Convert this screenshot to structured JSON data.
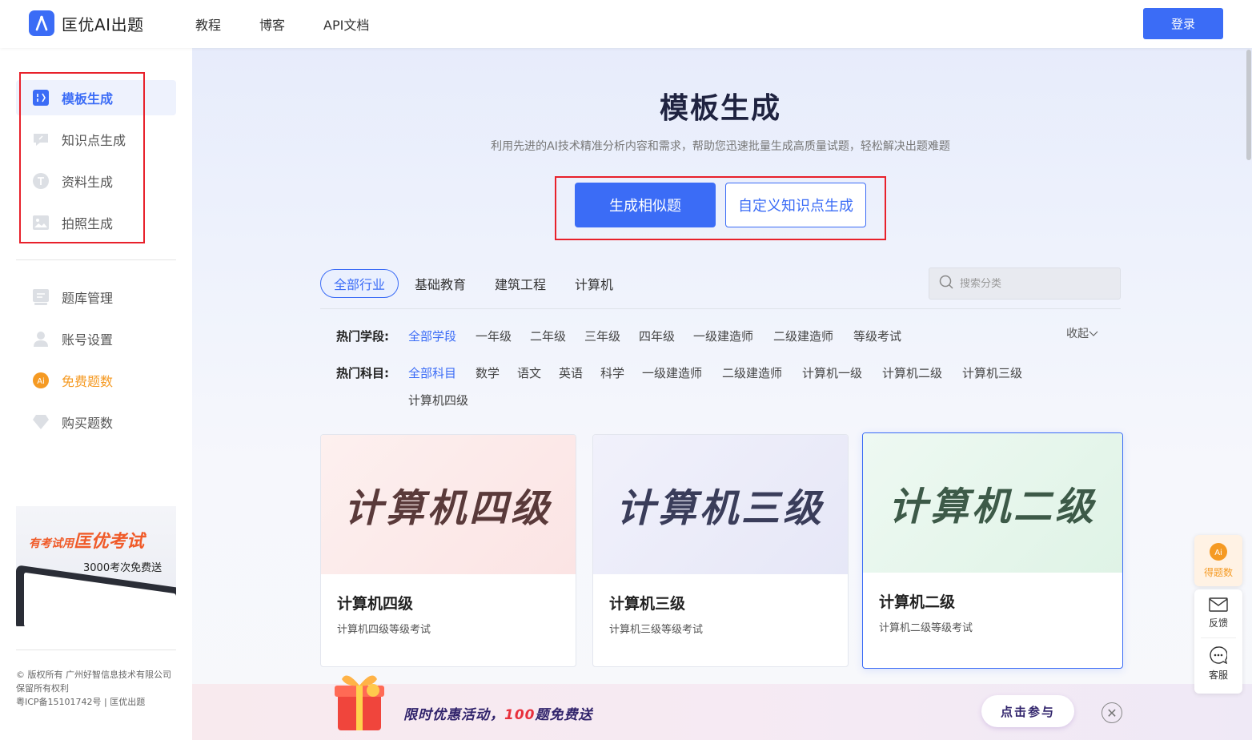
{
  "header": {
    "logo_text": "匡优AI出题",
    "nav": [
      "教程",
      "博客",
      "API文档"
    ],
    "login_label": "登录"
  },
  "sidebar": {
    "generate_items": [
      {
        "label": "模板生成",
        "icon": "template-icon"
      },
      {
        "label": "知识点生成",
        "icon": "knowledge-icon"
      },
      {
        "label": "资料生成",
        "icon": "document-icon"
      },
      {
        "label": "拍照生成",
        "icon": "photo-icon"
      }
    ],
    "manage_items": [
      {
        "label": "题库管理",
        "icon": "question-bank-icon"
      },
      {
        "label": "账号设置",
        "icon": "user-icon"
      },
      {
        "label": "免费题数",
        "icon": "ai-coin-icon"
      },
      {
        "label": "购买题数",
        "icon": "diamond-icon"
      }
    ],
    "promo": {
      "line1_small": "有考试用",
      "line1_big": "匡优考试",
      "line2": "3000考次免费送"
    },
    "copyright": {
      "line1": "© 版权所有 广州好智信息技术有限公司",
      "line2": "保留所有权利",
      "line3": "粤ICP备15101742号 | 匡优出题"
    }
  },
  "main": {
    "title": "模板生成",
    "description": "利用先进的AI技术精准分析内容和需求，帮助您迅速批量生成高质量试题，轻松解决出题难题",
    "primary_button": "生成相似题",
    "secondary_button": "自定义知识点生成",
    "tabs": [
      "全部行业",
      "基础教育",
      "建筑工程",
      "计算机"
    ],
    "search_placeholder": "搜索分类",
    "collapse_label": "收起",
    "stage_filter": {
      "label": "热门学段:",
      "options": [
        "全部学段",
        "一年级",
        "二年级",
        "三年级",
        "四年级",
        "一级建造师",
        "二级建造师",
        "等级考试"
      ]
    },
    "subject_filter": {
      "label": "热门科目:",
      "options": [
        "全部科目",
        "数学",
        "语文",
        "英语",
        "科学",
        "一级建造师",
        "二级建造师",
        "计算机一级",
        "计算机二级",
        "计算机三级",
        "计算机四级"
      ]
    },
    "cards": [
      {
        "banner": "计算机四级",
        "title": "计算机四级",
        "desc": "计算机四级等级考试",
        "color": "#5a3a3a",
        "bg": "#fbe7e6"
      },
      {
        "banner": "计算机三级",
        "title": "计算机三级",
        "desc": "计算机三级等级考试",
        "color": "#3a3d5a",
        "bg": "#e9eaf8"
      },
      {
        "banner": "计算机二级",
        "title": "计算机二级",
        "desc": "计算机二级等级考试",
        "color": "#3d5a48",
        "bg": "#e3f5ea"
      }
    ]
  },
  "bottom_banner": {
    "text_prefix": "限时优惠活动，",
    "text_number": "100",
    "text_suffix": "题免费送",
    "join_label": "点击参与",
    "close_symbol": "✕"
  },
  "float": {
    "points_label": "得题数",
    "feedback_label": "反馈",
    "service_label": "客服"
  },
  "colors": {
    "accent": "#3b6cf6",
    "highlight_box": "#e8212b",
    "orange": "#f59a23"
  }
}
